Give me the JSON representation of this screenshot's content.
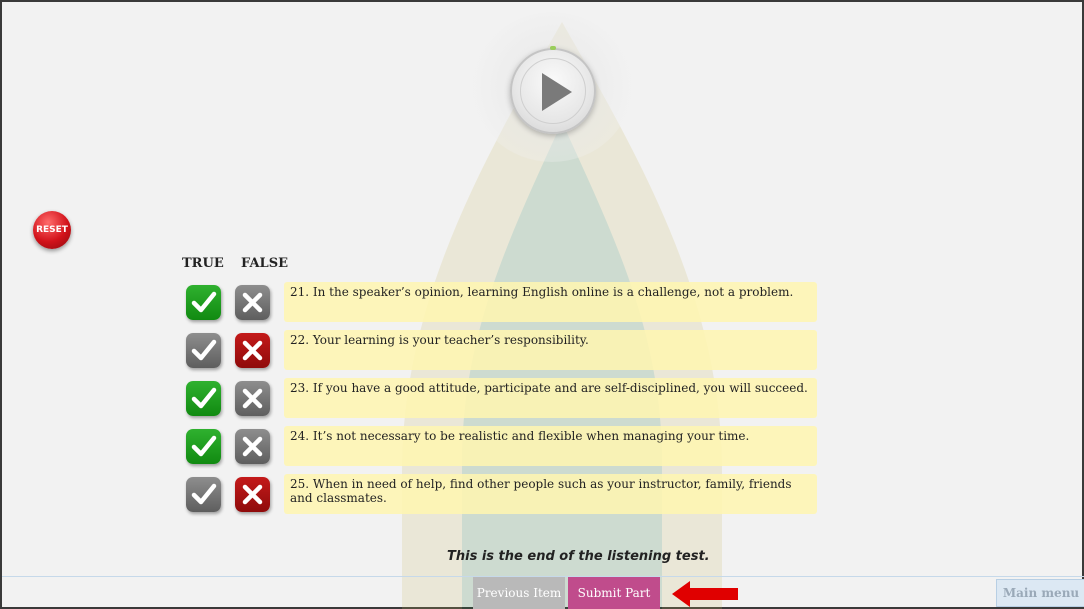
{
  "player": {
    "icon": "play-icon"
  },
  "reset": {
    "label": "RESET"
  },
  "columns": {
    "true_label": "TRUE",
    "false_label": "FALSE"
  },
  "questions": [
    {
      "text": "21. In the speaker’s opinion, learning English online is a challenge, not a problem.",
      "answer": "TRUE"
    },
    {
      "text": "22. Your learning is your teacher’s responsibility.",
      "answer": "FALSE"
    },
    {
      "text": "23. If you have a good attitude, participate and are self-disciplined, you will succeed.",
      "answer": "TRUE"
    },
    {
      "text": "24. It’s not necessary to be realistic and flexible when managing your time.",
      "answer": "TRUE"
    },
    {
      "text": "25. When in need of help, find other people such as your instructor, family, friends and classmates.",
      "answer": "FALSE"
    }
  ],
  "end_message": "This is the end of the listening test.",
  "footer": {
    "previous_label": "Previous Item",
    "submit_label": "Submit Part",
    "main_menu_label": "Main menu"
  },
  "colors": {
    "selected_true": "#1a9e1a",
    "selected_false": "#b31212",
    "unselected": "#777777",
    "question_bg": "#fff6b0",
    "submit": "#c04c8c",
    "arrow": "#e00000"
  }
}
